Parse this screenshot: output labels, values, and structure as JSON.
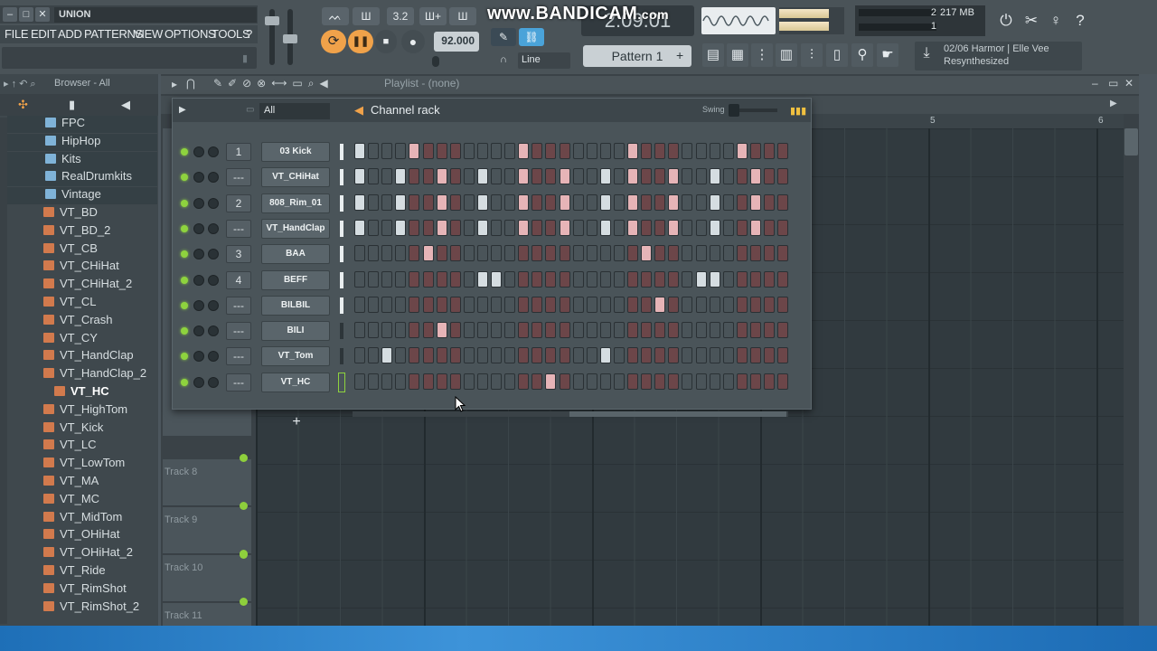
{
  "title": "UNION",
  "window_buttons": [
    "–",
    "□",
    "✕"
  ],
  "menu": [
    "FILE",
    "EDIT",
    "ADD",
    "PATTERNS",
    "VIEW",
    "OPTIONS",
    "TOOLS",
    "?"
  ],
  "transport": {
    "tempo": "92.000",
    "time": "2:09:01",
    "mode": "Line",
    "pattern": "Pattern 1",
    "pattern_add": "+",
    "top_icons": [
      "ᨓ",
      "Ш",
      "3.2",
      "Ш+",
      "Ш"
    ]
  },
  "watermark": {
    "main": "www.BANDICAM",
    "suffix": ".com"
  },
  "cpu": {
    "voices": "2",
    "ram": "217 MB",
    "cpu": "1"
  },
  "news": {
    "line1": "02/06  Harmor | Elle Vee",
    "line2": "Resynthesized"
  },
  "browser": {
    "header": "Browser - All",
    "items": [
      {
        "label": "FPC",
        "kind": "folder"
      },
      {
        "label": "HipHop",
        "kind": "folder"
      },
      {
        "label": "Kits",
        "kind": "folder"
      },
      {
        "label": "RealDrumkits",
        "kind": "folder"
      },
      {
        "label": "Vintage",
        "kind": "folder"
      },
      {
        "label": "VT_BD",
        "kind": "file"
      },
      {
        "label": "VT_BD_2",
        "kind": "file"
      },
      {
        "label": "VT_CB",
        "kind": "file"
      },
      {
        "label": "VT_CHiHat",
        "kind": "file"
      },
      {
        "label": "VT_CHiHat_2",
        "kind": "file"
      },
      {
        "label": "VT_CL",
        "kind": "file"
      },
      {
        "label": "VT_Crash",
        "kind": "file"
      },
      {
        "label": "VT_CY",
        "kind": "file"
      },
      {
        "label": "VT_HandClap",
        "kind": "file"
      },
      {
        "label": "VT_HandClap_2",
        "kind": "file"
      },
      {
        "label": "VT_HC",
        "kind": "file"
      },
      {
        "label": "VT_HighTom",
        "kind": "file"
      },
      {
        "label": "VT_Kick",
        "kind": "file"
      },
      {
        "label": "VT_LC",
        "kind": "file"
      },
      {
        "label": "VT_LowTom",
        "kind": "file"
      },
      {
        "label": "VT_MA",
        "kind": "file"
      },
      {
        "label": "VT_MC",
        "kind": "file"
      },
      {
        "label": "VT_MidTom",
        "kind": "file"
      },
      {
        "label": "VT_OHiHat",
        "kind": "file"
      },
      {
        "label": "VT_OHiHat_2",
        "kind": "file"
      },
      {
        "label": "VT_Ride",
        "kind": "file"
      },
      {
        "label": "VT_RimShot",
        "kind": "file"
      },
      {
        "label": "VT_RimShot_2",
        "kind": "file"
      }
    ]
  },
  "playlist": {
    "title": "Playlist - (none)",
    "ruler": [
      "5",
      "6"
    ],
    "tracks": [
      "Track 8",
      "Track 9",
      "Track 10",
      "Track 11"
    ]
  },
  "channel_rack": {
    "title": "Channel rack",
    "filter": "All",
    "swing_label": "Swing",
    "add": "+",
    "channels": [
      {
        "num": "1",
        "name": "03 Kick",
        "steps": [
          0,
          0,
          0,
          0,
          1,
          0,
          0,
          0,
          0,
          0,
          0,
          0,
          0,
          0,
          0,
          0,
          0,
          0,
          0,
          0,
          0,
          0,
          0,
          0,
          0,
          0,
          0,
          0,
          0,
          0,
          0,
          0
        ],
        "selected": true
      },
      {
        "num": "---",
        "name": "VT_CHiHat",
        "steps": [
          0,
          0,
          0,
          0,
          0,
          0,
          0,
          0,
          0,
          0,
          0,
          0,
          0,
          0,
          0,
          0,
          0,
          0,
          0,
          0,
          0,
          0,
          0,
          0,
          0,
          0,
          0,
          0,
          0,
          0,
          0,
          0
        ],
        "selected": true
      },
      {
        "num": "2",
        "name": "808_Rim_01",
        "steps": [
          0,
          0,
          0,
          0,
          0,
          0,
          0,
          0,
          0,
          0,
          0,
          0,
          0,
          0,
          0,
          0,
          0,
          0,
          0,
          0,
          0,
          0,
          0,
          0,
          0,
          0,
          0,
          0,
          0,
          0,
          0,
          0
        ],
        "selected": true
      },
      {
        "num": "---",
        "name": "VT_HandClap",
        "steps": [
          0,
          0,
          0,
          0,
          0,
          0,
          0,
          0,
          0,
          0,
          0,
          0,
          0,
          0,
          0,
          0,
          0,
          0,
          0,
          0,
          0,
          0,
          0,
          0,
          0,
          0,
          0,
          0,
          0,
          0,
          0,
          0
        ],
        "selected": true
      },
      {
        "num": "3",
        "name": "BAA",
        "steps": [
          0,
          0,
          0,
          0,
          0,
          0,
          0,
          0,
          0,
          0,
          0,
          0,
          0,
          0,
          0,
          0,
          0,
          0,
          0,
          0,
          0,
          0,
          0,
          0,
          0,
          0,
          0,
          0,
          0,
          0,
          0,
          0
        ],
        "selected": true
      },
      {
        "num": "4",
        "name": "BEFF",
        "steps": [
          0,
          0,
          0,
          0,
          0,
          0,
          0,
          0,
          0,
          0,
          0,
          0,
          0,
          0,
          0,
          0,
          0,
          0,
          0,
          0,
          0,
          0,
          0,
          0,
          0,
          0,
          0,
          0,
          0,
          0,
          0,
          0
        ],
        "selected": true
      },
      {
        "num": "---",
        "name": "BILBIL",
        "steps": [
          0,
          0,
          0,
          0,
          0,
          0,
          0,
          0,
          0,
          0,
          0,
          0,
          0,
          0,
          0,
          0,
          0,
          0,
          0,
          0,
          0,
          0,
          0,
          0,
          0,
          0,
          0,
          0,
          0,
          0,
          0,
          0
        ],
        "selected": true
      },
      {
        "num": "---",
        "name": "BILI",
        "steps": [
          0,
          0,
          0,
          0,
          0,
          0,
          0,
          0,
          0,
          0,
          0,
          0,
          0,
          0,
          0,
          0,
          0,
          0,
          0,
          0,
          0,
          0,
          0,
          0,
          0,
          0,
          0,
          0,
          0,
          0,
          0,
          0
        ],
        "selected": false
      },
      {
        "num": "---",
        "name": "VT_Tom",
        "steps": [
          0,
          0,
          0,
          0,
          0,
          0,
          0,
          0,
          0,
          0,
          0,
          0,
          0,
          0,
          0,
          0,
          0,
          0,
          0,
          0,
          0,
          0,
          0,
          0,
          0,
          0,
          0,
          0,
          0,
          0,
          0,
          0
        ],
        "selected": false
      },
      {
        "num": "---",
        "name": "VT_HC",
        "steps": [
          0,
          0,
          0,
          0,
          0,
          0,
          0,
          0,
          0,
          0,
          0,
          0,
          0,
          0,
          0,
          0,
          0,
          0,
          0,
          0,
          0,
          0,
          0,
          0,
          0,
          0,
          0,
          0,
          0,
          0,
          0,
          0
        ],
        "selected": false
      }
    ],
    "patterns": [
      [
        1,
        0,
        0,
        0,
        1,
        0,
        0,
        0,
        0,
        0,
        0,
        0,
        1,
        0,
        0,
        0,
        0,
        0,
        0,
        0,
        1,
        0,
        0,
        0,
        0,
        0,
        0,
        0,
        1,
        0,
        0,
        0
      ],
      [
        1,
        0,
        0,
        1,
        0,
        0,
        1,
        0,
        0,
        1,
        0,
        0,
        1,
        0,
        0,
        1,
        0,
        0,
        1,
        0,
        1,
        0,
        0,
        1,
        0,
        0,
        1,
        0,
        0,
        1,
        0,
        0
      ],
      [
        1,
        0,
        0,
        1,
        0,
        0,
        1,
        0,
        0,
        1,
        0,
        0,
        1,
        0,
        0,
        1,
        0,
        0,
        1,
        0,
        1,
        0,
        0,
        1,
        0,
        0,
        1,
        0,
        0,
        1,
        0,
        0
      ],
      [
        1,
        0,
        0,
        1,
        0,
        0,
        1,
        0,
        0,
        1,
        0,
        0,
        1,
        0,
        0,
        1,
        0,
        0,
        1,
        0,
        1,
        0,
        0,
        1,
        0,
        0,
        1,
        0,
        0,
        1,
        0,
        0
      ],
      [
        0,
        0,
        0,
        0,
        0,
        1,
        0,
        0,
        0,
        0,
        0,
        0,
        0,
        0,
        0,
        0,
        0,
        0,
        0,
        0,
        0,
        1,
        0,
        0,
        0,
        0,
        0,
        0,
        0,
        0,
        0,
        0
      ],
      [
        0,
        0,
        0,
        0,
        0,
        0,
        0,
        0,
        0,
        1,
        1,
        0,
        0,
        0,
        0,
        0,
        0,
        0,
        0,
        0,
        0,
        0,
        0,
        0,
        0,
        1,
        1,
        0,
        0,
        0,
        0,
        0
      ],
      [
        0,
        0,
        0,
        0,
        0,
        0,
        0,
        0,
        0,
        0,
        0,
        0,
        0,
        0,
        0,
        0,
        0,
        0,
        0,
        0,
        0,
        0,
        1,
        0,
        0,
        0,
        0,
        0,
        0,
        0,
        0,
        0
      ],
      [
        0,
        0,
        0,
        0,
        0,
        0,
        1,
        0,
        0,
        0,
        0,
        0,
        0,
        0,
        0,
        0,
        0,
        0,
        0,
        0,
        0,
        0,
        0,
        0,
        0,
        0,
        0,
        0,
        0,
        0,
        0,
        0
      ],
      [
        0,
        0,
        1,
        0,
        0,
        0,
        0,
        0,
        0,
        0,
        0,
        0,
        0,
        0,
        0,
        0,
        0,
        0,
        1,
        0,
        0,
        0,
        0,
        0,
        0,
        0,
        0,
        0,
        0,
        0,
        0,
        0
      ],
      [
        0,
        0,
        0,
        0,
        0,
        0,
        0,
        0,
        0,
        0,
        0,
        0,
        0,
        0,
        1,
        0,
        0,
        0,
        0,
        0,
        0,
        0,
        0,
        0,
        0,
        0,
        0,
        0,
        0,
        0,
        0,
        0
      ]
    ]
  },
  "colors": {
    "accent": "#f0a24a",
    "led": "#8ed33e",
    "step_on_gray": "#d5dde1",
    "step_on_red": "#e6b4b7"
  }
}
